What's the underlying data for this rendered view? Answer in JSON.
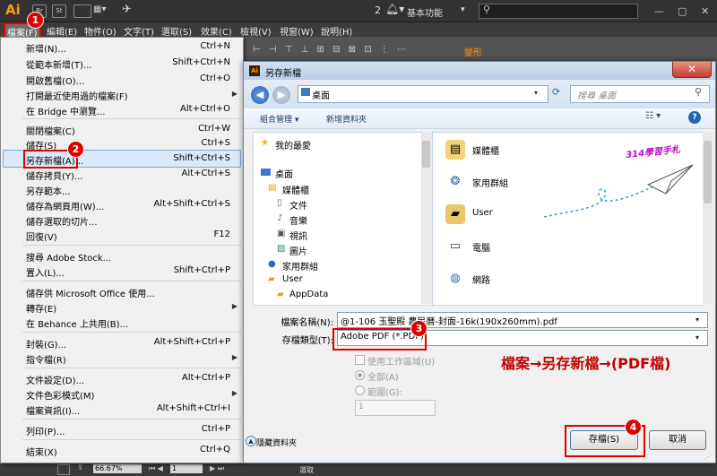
{
  "app": {
    "logo": "Ai",
    "box_br": "Br",
    "box_st": "St",
    "notification_count": "2",
    "workspace": "基本功能",
    "status_zoom": "66.67%",
    "status_page": "1",
    "status_label": "選取",
    "control_label": "變形"
  },
  "menubar": {
    "items": [
      "檔案(F)",
      "編輯(E)",
      "物件(O)",
      "文字(T)",
      "選取(S)",
      "效果(C)",
      "檢視(V)",
      "視窗(W)",
      "說明(H)"
    ]
  },
  "file_menu": {
    "items": [
      {
        "label": "新增(N)...",
        "shortcut": "Ctrl+N"
      },
      {
        "label": "從範本新增(T)...",
        "shortcut": "Shift+Ctrl+N"
      },
      {
        "label": "開啟舊檔(O)...",
        "shortcut": "Ctrl+O"
      },
      {
        "label": "打開最近使用過的檔案(F)",
        "shortcut": ""
      },
      {
        "label": "在 Bridge 中瀏覽...",
        "shortcut": "Alt+Ctrl+O"
      },
      {
        "label": "關閉檔案(C)",
        "shortcut": "Ctrl+W"
      },
      {
        "label": "儲存(S)",
        "shortcut": "Ctrl+S"
      },
      {
        "label": "另存新檔(A)...",
        "shortcut": "Shift+Ctrl+S"
      },
      {
        "label": "儲存拷貝(Y)...",
        "shortcut": "Alt+Ctrl+S"
      },
      {
        "label": "另存範本...",
        "shortcut": ""
      },
      {
        "label": "儲存為網頁用(W)...",
        "shortcut": "Alt+Shift+Ctrl+S"
      },
      {
        "label": "儲存選取的切片...",
        "shortcut": ""
      },
      {
        "label": "回復(V)",
        "shortcut": "F12"
      },
      {
        "label": "搜尋 Adobe Stock...",
        "shortcut": ""
      },
      {
        "label": "置入(L)...",
        "shortcut": "Shift+Ctrl+P"
      },
      {
        "label": "儲存供 Microsoft Office 使用...",
        "shortcut": ""
      },
      {
        "label": "轉存(E)",
        "shortcut": ""
      },
      {
        "label": "在 Behance 上共用(B)...",
        "shortcut": ""
      },
      {
        "label": "封裝(G)...",
        "shortcut": "Alt+Shift+Ctrl+P"
      },
      {
        "label": "指令檔(R)",
        "shortcut": ""
      },
      {
        "label": "文件設定(D)...",
        "shortcut": "Alt+Ctrl+P"
      },
      {
        "label": "文件色彩模式(M)",
        "shortcut": ""
      },
      {
        "label": "檔案資訊(I)...",
        "shortcut": "Alt+Shift+Ctrl+I"
      },
      {
        "label": "列印(P)...",
        "shortcut": "Ctrl+P"
      },
      {
        "label": "結束(X)",
        "shortcut": "Ctrl+Q"
      }
    ]
  },
  "dialog": {
    "title": "另存新檔",
    "close": "✕",
    "address": "桌面",
    "search_placeholder": "搜尋 桌面",
    "organize": "組合管理 ▾",
    "new_folder": "新增資料夾",
    "nav_items": [
      "我的最愛",
      "桌面",
      "媒體櫃",
      "文件",
      "音樂",
      "視訊",
      "圖片",
      "家用群組",
      "User",
      "AppData"
    ],
    "files": [
      "媒體櫃",
      "家用群組",
      "User",
      "電腦",
      "網路"
    ],
    "brand_text": "314學習手札",
    "filename_label": "檔案名稱(N):",
    "filename_value": "@1-106 玉聖殿 農民曆-封面-16k(190x260mm).pdf",
    "filetype_label": "存檔類型(T):",
    "filetype_value": "Adobe PDF (*.PDF)",
    "use_artboards": "使用工作區域(U)",
    "all_option": "全部(A)",
    "range_option": "範圍(G):",
    "range_value": "1",
    "hide_folders": "隱藏資料夾",
    "save_button": "存檔(S)",
    "cancel_button": "取消",
    "callout": "檔案→另存新檔→(PDF檔)"
  },
  "badges": [
    "1",
    "2",
    "3",
    "4"
  ]
}
